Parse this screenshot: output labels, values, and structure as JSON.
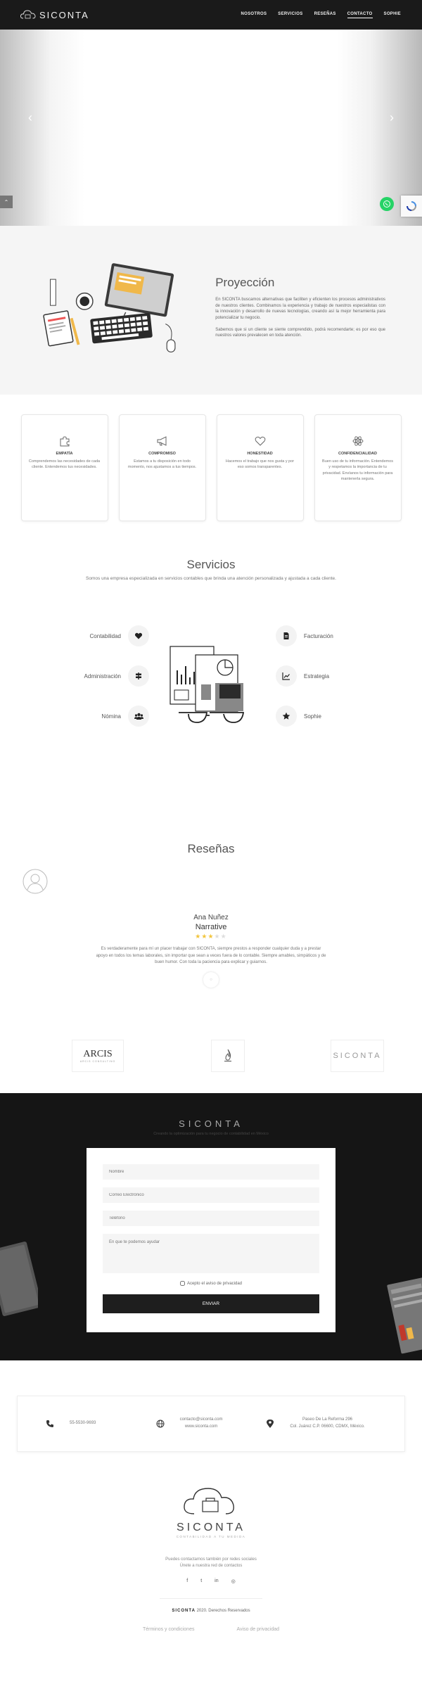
{
  "nav": {
    "brand": "SICONTA",
    "items": [
      "NOSOTROS",
      "SERVICIOS",
      "RESEÑAS",
      "CONTACTO",
      "SOPHIE"
    ]
  },
  "hero": {
    "prev": "‹",
    "next": "›",
    "back_top": "⌃"
  },
  "proyeccion": {
    "title": "Proyección",
    "p1": "En SICONTA buscamos alternativas que faciliten y eficienten los procesos administrativos de nuestros clientes. Combinamos la experiencia y trabajo de nuestros especialistas con la innovación y desarrollo de nuevas tecnologías, creando así la mejor herramienta para potencializar tu negocio.",
    "p2": "Sabemos que si un cliente se siente comprendido, podrá recomendarte; es por eso que nuestros valores prevalecen en toda atención."
  },
  "values": [
    {
      "title": "EMPATÍA",
      "text": "Comprendemos las necesidades de cada cliente. Entendemos tus necesidades."
    },
    {
      "title": "COMPROMISO",
      "text": "Estamos a tu disposición en todo momento, nos ajustamos a tus tiempos."
    },
    {
      "title": "HONESTIDAD",
      "text": "Hacemos el trabajo que nos gusta y por eso somos transparentes."
    },
    {
      "title": "CONFIDENCIALIDAD",
      "text": "Buen uso de tu información. Entendemos y respetamos la importancia de tu privacidad. Envíanos tu información para mantenerla segura."
    }
  ],
  "servicios": {
    "title": "Servicios",
    "subtitle": "Somos una empresa especializada en servicios contables que brinda una atención personalizada y ajustada a cada cliente.",
    "left": [
      "Contabilidad",
      "Administración",
      "Nómina"
    ],
    "right": [
      "Facturación",
      "Estrategia",
      "Sophie"
    ]
  },
  "resenas": {
    "title": "Reseñas",
    "name": "Ana Nuñez",
    "company": "Narrative",
    "rating": 3,
    "stars_max": 5,
    "text": "Es verdaderamente para mí un placer trabajar con SICONTA, siempre prestos a responder cualquier duda y a prestar apoyo en todos los temas laborales, sin importar que sean a veces fuera de lo contable. Siempre amables, simpáticos y de buen humor. Con toda la paciencia para explicar y guiarnos.",
    "dot": "○"
  },
  "logos": {
    "arcis": "ARCIS",
    "arcis_sub": "ARCIS CONSULTING",
    "siconta": "SICONTA"
  },
  "contact": {
    "title": "SICONTA",
    "tagline": "Creando la optimización para tu negocio de contabilidad en México",
    "name_ph": "Nombre",
    "email_ph": "Correo Electrónico",
    "phone_ph": "Teléfono",
    "msg_ph": "En que te podemos ayudar",
    "privacy": "Acepto el aviso de privacidad",
    "send": "ENVIAR"
  },
  "info": {
    "phone": "55-5530-9693",
    "email": "contacto@siconta.com",
    "web": "www.siconta.com",
    "addr1": "Paseo De La Reforma 296",
    "addr2": "Col. Juárez C.P. 06600, CDMX, México."
  },
  "footer": {
    "brand": "SICONTA",
    "slogan": "CONTABILIDAD A TU MEDIDA",
    "msg1": "Puedes contactarnos también por redes sociales",
    "msg2": "Únete a nuestra red de contactos",
    "socials": [
      "f",
      "t",
      "in",
      "◎"
    ],
    "copy_brand": "SICONTA",
    "copy_rest": " 2020. Derechos Reservados",
    "terms": "Términos y condiciones",
    "privacy": "Aviso de privacidad"
  }
}
